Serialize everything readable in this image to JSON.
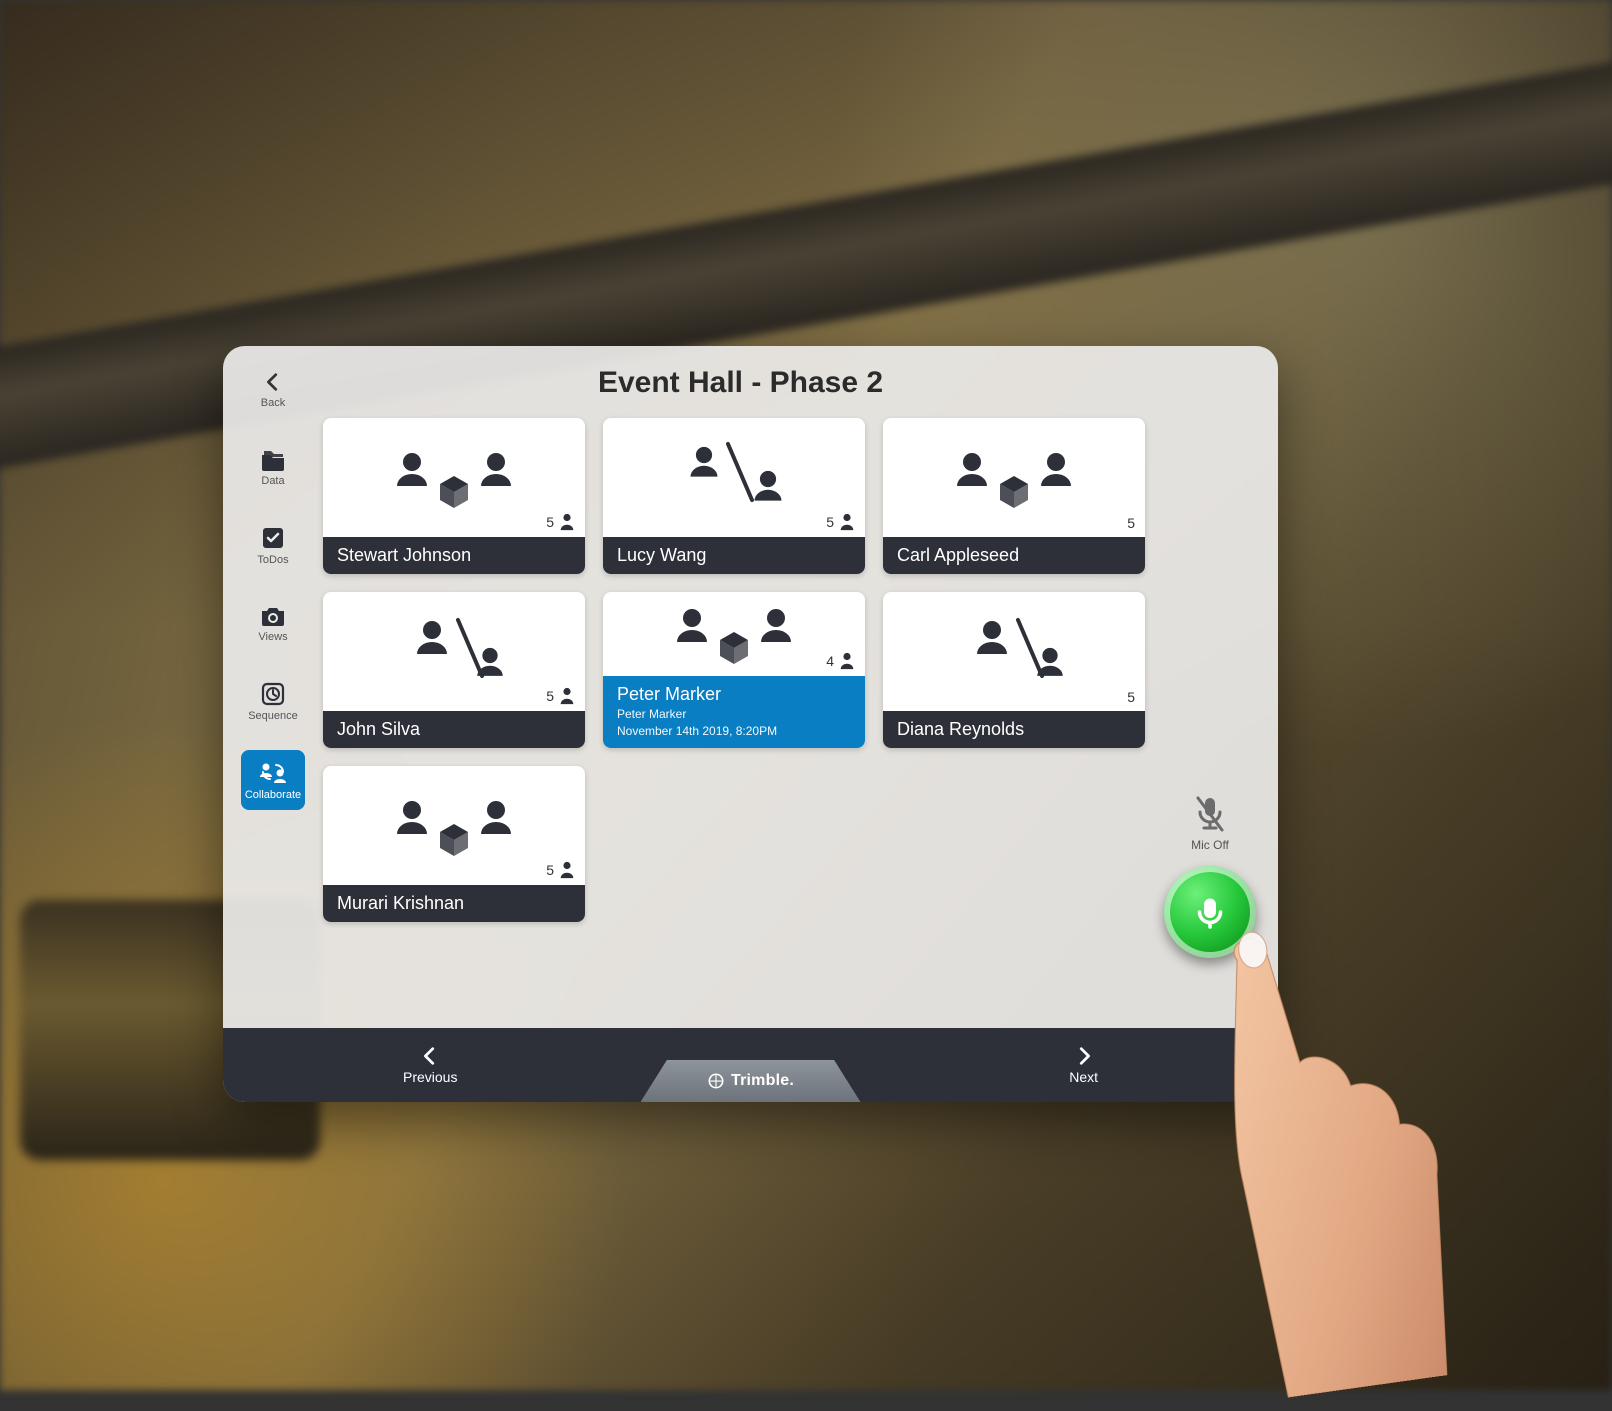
{
  "header": {
    "title": "Event Hall - Phase 2"
  },
  "sidebar": {
    "back": "Back",
    "items": [
      {
        "label": "Data"
      },
      {
        "label": "ToDos"
      },
      {
        "label": "Views"
      },
      {
        "label": "Sequence"
      },
      {
        "label": "Collaborate",
        "active": true
      }
    ]
  },
  "cards": [
    {
      "name": "Stewart Johnson",
      "count": "5",
      "style": "group-box",
      "extra_icon": true
    },
    {
      "name": "Lucy Wang",
      "count": "5",
      "style": "group-slash",
      "extra_icon": true
    },
    {
      "name": "Carl Appleseed",
      "count": "5",
      "style": "group-box"
    },
    {
      "name": "John Silva",
      "count": "5",
      "style": "single-slash",
      "extra_icon": true
    },
    {
      "name": "Peter Marker",
      "count": "4",
      "style": "group-box",
      "extra_icon": true,
      "selected": true,
      "sub1": "Peter Marker",
      "sub2": "November 14th 2019, 8:20PM"
    },
    {
      "name": "Diana Reynolds",
      "count": "5",
      "style": "single-slash"
    },
    {
      "name": "Murari Krishnan",
      "count": "5",
      "style": "group-box",
      "extra_icon": true
    }
  ],
  "mic": {
    "label": "Mic Off"
  },
  "footer": {
    "prev": "Previous",
    "next": "Next",
    "brand": "Trimble."
  }
}
